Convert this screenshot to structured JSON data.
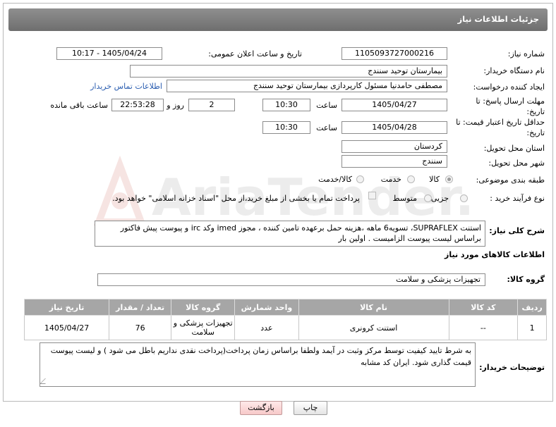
{
  "header": {
    "title": "جزئیات اطلاعات نیاز"
  },
  "fields": {
    "need_number": {
      "label": "شماره نیاز:",
      "value": "1105093727000216"
    },
    "announce_datetime": {
      "label": "تاریخ و ساعت اعلان عمومی:",
      "value": "1405/04/24 - 10:17"
    },
    "buyer_org": {
      "label": "نام دستگاه خریدار:",
      "value": "بیمارستان توحید سنندج"
    },
    "requester": {
      "label": "ایجاد کننده درخواست:",
      "value": "مصطفی حامدنیا مسئول کارپردازی بیمارستان توحید سنندج",
      "link": "اطلاعات تماس خریدار"
    },
    "reply_deadline": {
      "label": "مهلت ارسال پاسخ: تا تاریخ:",
      "date": "1405/04/27",
      "time_label": "ساعت",
      "time": "10:30",
      "days": "2",
      "days_label": "روز و",
      "remaining": "22:53:28",
      "remaining_label": "ساعت باقی مانده"
    },
    "price_validity": {
      "label": "حداقل تاریخ اعتبار قیمت: تا تاریخ:",
      "date": "1405/04/28",
      "time_label": "ساعت",
      "time": "10:30"
    },
    "province": {
      "label": "استان محل تحویل:",
      "value": "کردستان"
    },
    "city": {
      "label": "شهر محل تحویل:",
      "value": "سنندج"
    },
    "category": {
      "label": "طبقه بندی موضوعی:",
      "options": [
        "کالا",
        "خدمت",
        "کالا/خدمت"
      ],
      "selected": "کالا"
    },
    "purchase_type": {
      "label": "نوع فرآیند خرید :",
      "options": [
        "جزیی",
        "متوسط"
      ],
      "selected": "",
      "note": "پرداخت تمام یا بخشی از مبلغ خرید،از محل \"اسناد خزانه اسلامی\" خواهد بود."
    }
  },
  "description": {
    "label": "شرح کلی نیاز:",
    "text": "استنت SUPRAFLEX، تسویه6 ماهه ،هزینه حمل برعهده تامین کننده ، مجوز imed وکد irc و پیوست پیش فاکتور براساس لیست پیوست الزامیست . اولین بار"
  },
  "goods": {
    "title": "اطلاعات کالاهای مورد نیاز",
    "group_label": "گروه کالا:",
    "group_value": "تجهیزات پزشکی و سلامت",
    "columns": [
      "ردیف",
      "کد کالا",
      "نام کالا",
      "واحد شمارش",
      "گروه کالا",
      "تعداد / مقدار",
      "تاریخ نیاز"
    ],
    "rows": [
      {
        "index": "1",
        "code": "--",
        "name": "استنت کرونری",
        "unit": "عدد",
        "group": "تجهیزات پزشکی و سلامت",
        "qty": "76",
        "date": "1405/04/27"
      }
    ]
  },
  "buyer_notes": {
    "label": "توضیحات خریدار:",
    "text": "به شرط تایید کیفیت توسط مرکز وثبت در آیمد ولطفا براساس زمان پرداخت(پرداخت نقدی نداریم باطل می شود ) و لیست پیوست قیمت گذاری شود. ایران کد مشابه"
  },
  "buttons": {
    "print": "چاپ",
    "back": "بازگشت"
  },
  "watermark": "AriaTender.neT",
  "colors": {
    "header": "#7d7d7d",
    "table_header": "#a6a6a6",
    "link": "#2a5db0",
    "back_button": "#f7c9c9"
  }
}
